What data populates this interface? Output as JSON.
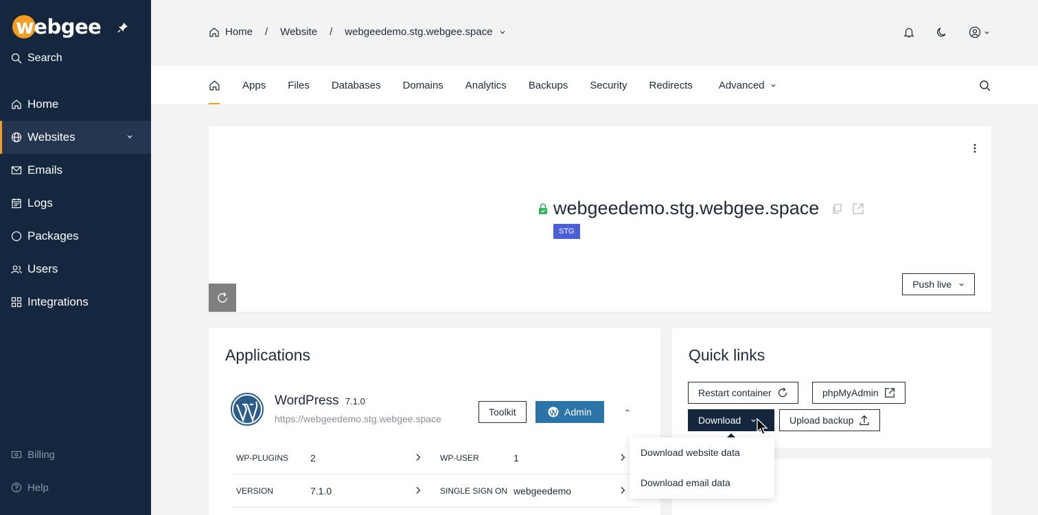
{
  "sidebar": {
    "logo": "webgee",
    "search_label": "Search",
    "items": [
      {
        "label": "Home",
        "icon": "home-icon"
      },
      {
        "label": "Websites",
        "icon": "globe-icon"
      },
      {
        "label": "Emails",
        "icon": "mail-icon"
      },
      {
        "label": "Logs",
        "icon": "logs-icon"
      },
      {
        "label": "Packages",
        "icon": "packages-icon"
      },
      {
        "label": "Users",
        "icon": "users-icon"
      },
      {
        "label": "Integrations",
        "icon": "integrations-icon"
      }
    ],
    "bottom": [
      {
        "label": "Billing",
        "icon": "billing-icon"
      },
      {
        "label": "Help",
        "icon": "help-icon"
      }
    ]
  },
  "breadcrumb": {
    "home": "Home",
    "website": "Website",
    "site": "webgeedemo.stg.webgee.space"
  },
  "tabs": [
    "Apps",
    "Files",
    "Databases",
    "Domains",
    "Analytics",
    "Backups",
    "Security",
    "Redirects",
    "Advanced"
  ],
  "site": {
    "title": "webgeedemo.stg.webgee.space",
    "badge": "STG",
    "push_live": "Push live"
  },
  "applications": {
    "title": "Applications",
    "app_name": "WordPress",
    "app_version": "7.1.0",
    "app_url": "https://webgeedemo.stg.webgee.space",
    "toolkit": "Toolkit",
    "admin": "Admin",
    "rows": [
      {
        "k1": "WP-PLUGINS",
        "v1": "2",
        "k2": "WP-USER",
        "v2": "1"
      },
      {
        "k1": "VERSION",
        "v1": "7.1.0",
        "k2": "SINGLE SIGN ON",
        "v2": "webgeedemo"
      }
    ]
  },
  "quick_links": {
    "title": "Quick links",
    "restart": "Restart container",
    "phpmyadmin": "phpMyAdmin",
    "download": "Download",
    "upload": "Upload backup"
  },
  "download_menu": {
    "website": "Download website data",
    "email": "Download email data"
  },
  "colors": {
    "sidebar_bg": "#15273f",
    "accent": "#f39c1f",
    "badge": "#4a5fd8",
    "admin_btn": "#2a74a8"
  }
}
